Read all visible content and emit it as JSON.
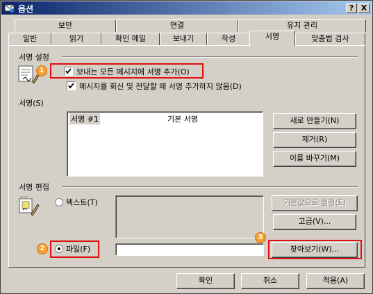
{
  "window": {
    "title": "옵션"
  },
  "titlebar": {
    "help_label": "?",
    "close_label": "X"
  },
  "tabs_row1": [
    "보안",
    "연결",
    "유지 관리"
  ],
  "tabs_row2": [
    "일반",
    "읽기",
    "확인 메일",
    "보내기",
    "작성",
    "서명",
    "맞춤법 검사"
  ],
  "sig_settings": {
    "heading": "서명 설정",
    "check1_label": "보내는 모든 메시지에 서명 추가(O)",
    "check2_label": "메시지를 회신 및 전달할 때 서명 추가하지 않음(D)"
  },
  "signatures": {
    "heading": "서명(S)",
    "list": [
      {
        "name": "서명 #1",
        "type": "기본 서명"
      }
    ],
    "new_button": "새로 만들기(N)",
    "remove_button": "제거(R)",
    "rename_button": "이름 바꾸기(M)"
  },
  "sig_edit": {
    "heading": "서명 편집",
    "text_option": "텍스트(T)",
    "file_option": "파일(F)",
    "file_value": "",
    "set_default_button": "기본값으로 설정(E)",
    "advanced_button": "고급(V)...",
    "browse_button": "찾아보기(W)..."
  },
  "footer": {
    "ok": "확인",
    "cancel": "취소",
    "apply": "적용(A)"
  },
  "callouts": [
    "1",
    "2",
    "3"
  ]
}
